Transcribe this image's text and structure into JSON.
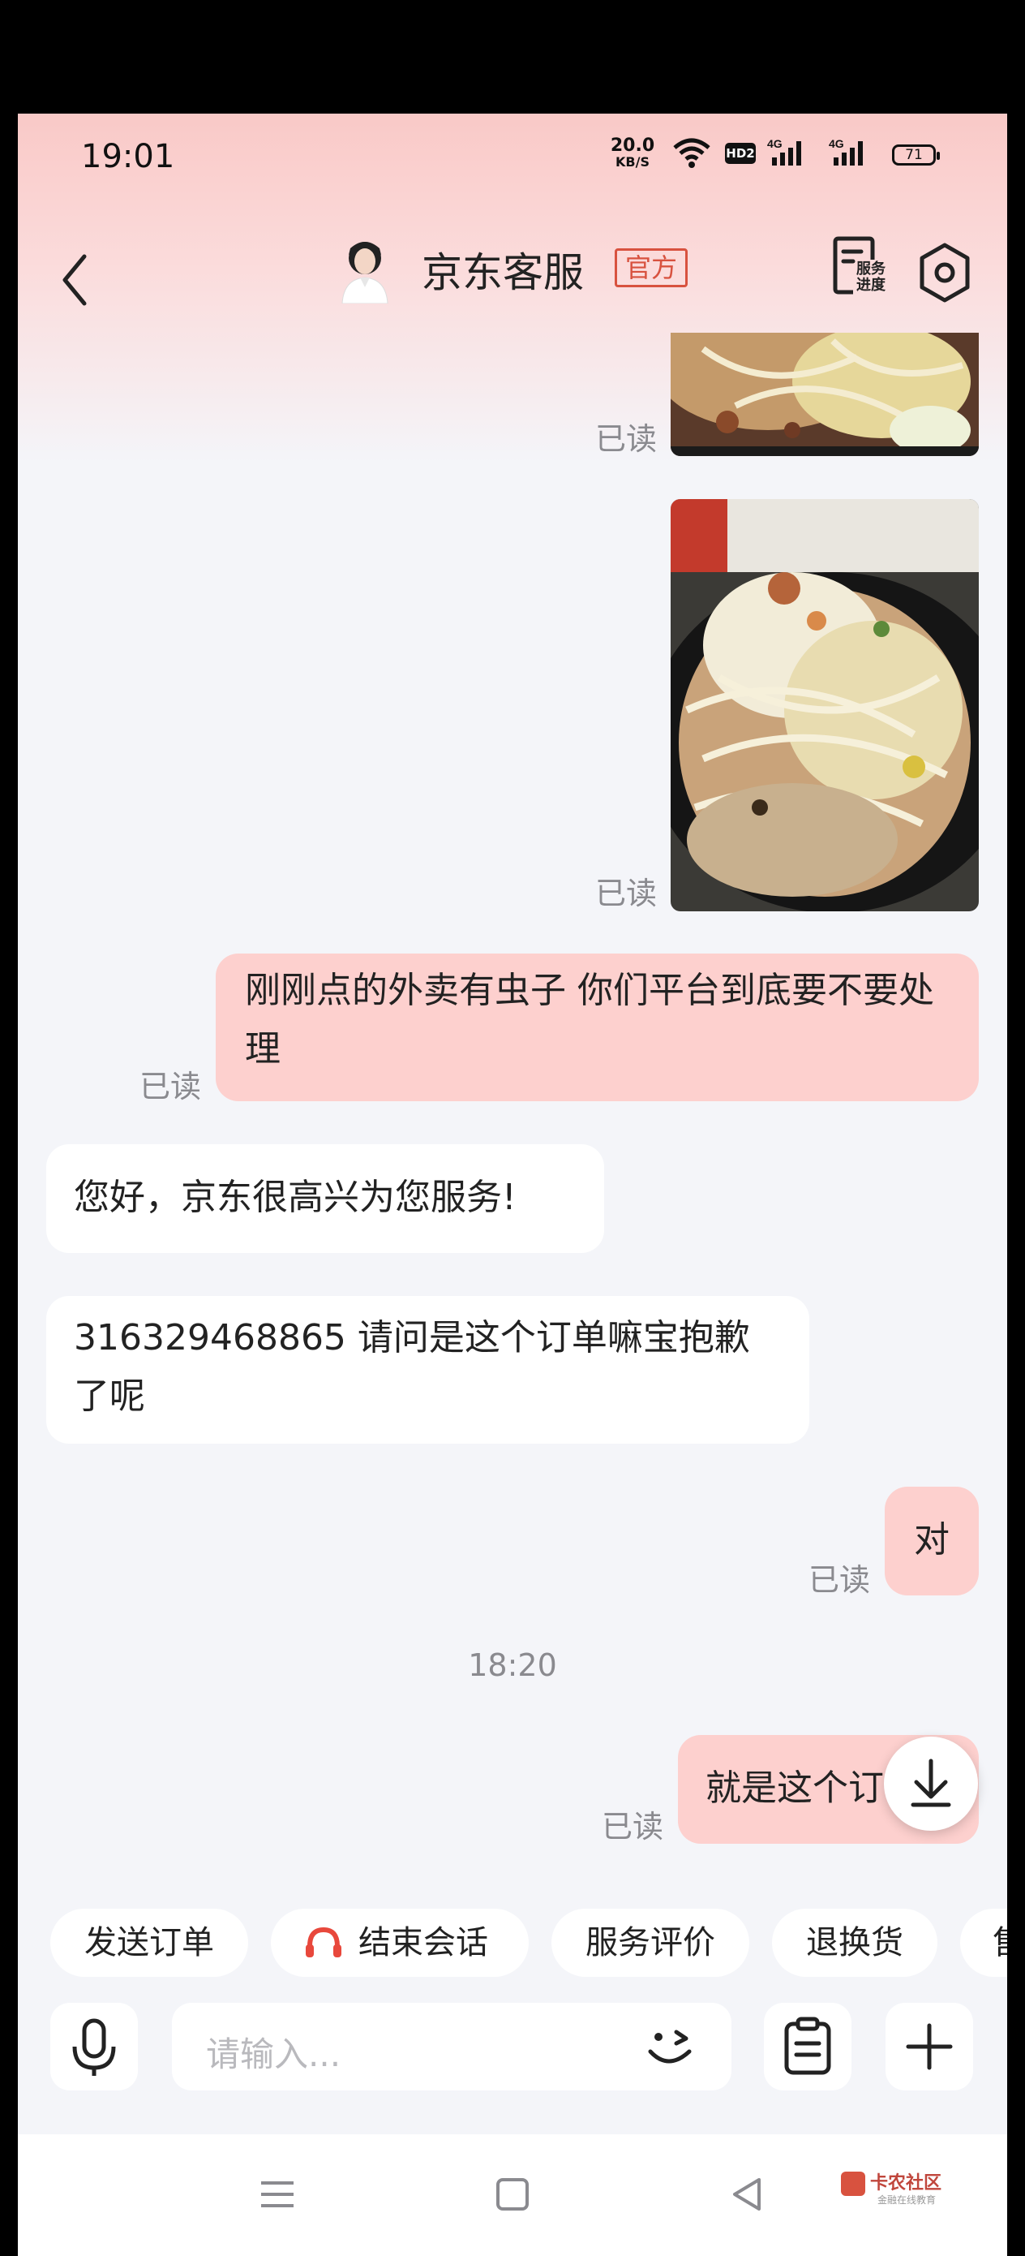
{
  "status_bar": {
    "time": "19:01",
    "net_speed": "20.0",
    "net_speed_unit": "KB/S",
    "hd_label": "HD2",
    "sim1_label": "4G",
    "sim2_label": "4G",
    "battery": "71"
  },
  "header": {
    "title": "京东客服",
    "badge": "官方",
    "service_progress_label_line1": "服务",
    "service_progress_label_line2": "进度"
  },
  "messages": {
    "read_label": "已读",
    "msg3_text": "刚刚点的外卖有虫子 你们平台到底要不要处理",
    "msg4_text": "您好，京东很高兴为您服务!",
    "msg5_text": "316329468865  请问是这个订单嘛宝抱歉了呢",
    "msg6_text": "对",
    "time_divider": "18:20",
    "msg7_text": "就是这个订"
  },
  "quick_actions": {
    "send_order": "发送订单",
    "end_session": "结束会话",
    "service_review": "服务评价",
    "return_exchange": "退换货",
    "partial_next": "售"
  },
  "input": {
    "placeholder": "请输入..."
  },
  "watermark": {
    "text": "卡农社区",
    "sub": "金融在线教育"
  },
  "colors": {
    "accent": "#d8523f",
    "my_bubble": "#fdd0ce",
    "headset_icon": "#e8483c"
  },
  "icons": [
    "back-arrow-icon",
    "wifi-icon",
    "signal-icon",
    "battery-icon",
    "service-progress-icon",
    "settings-icon",
    "download-arrow-icon",
    "headset-icon",
    "microphone-icon",
    "emoji-icon",
    "clipboard-icon",
    "plus-icon",
    "menu-icon",
    "home-icon",
    "back-triangle-icon"
  ]
}
